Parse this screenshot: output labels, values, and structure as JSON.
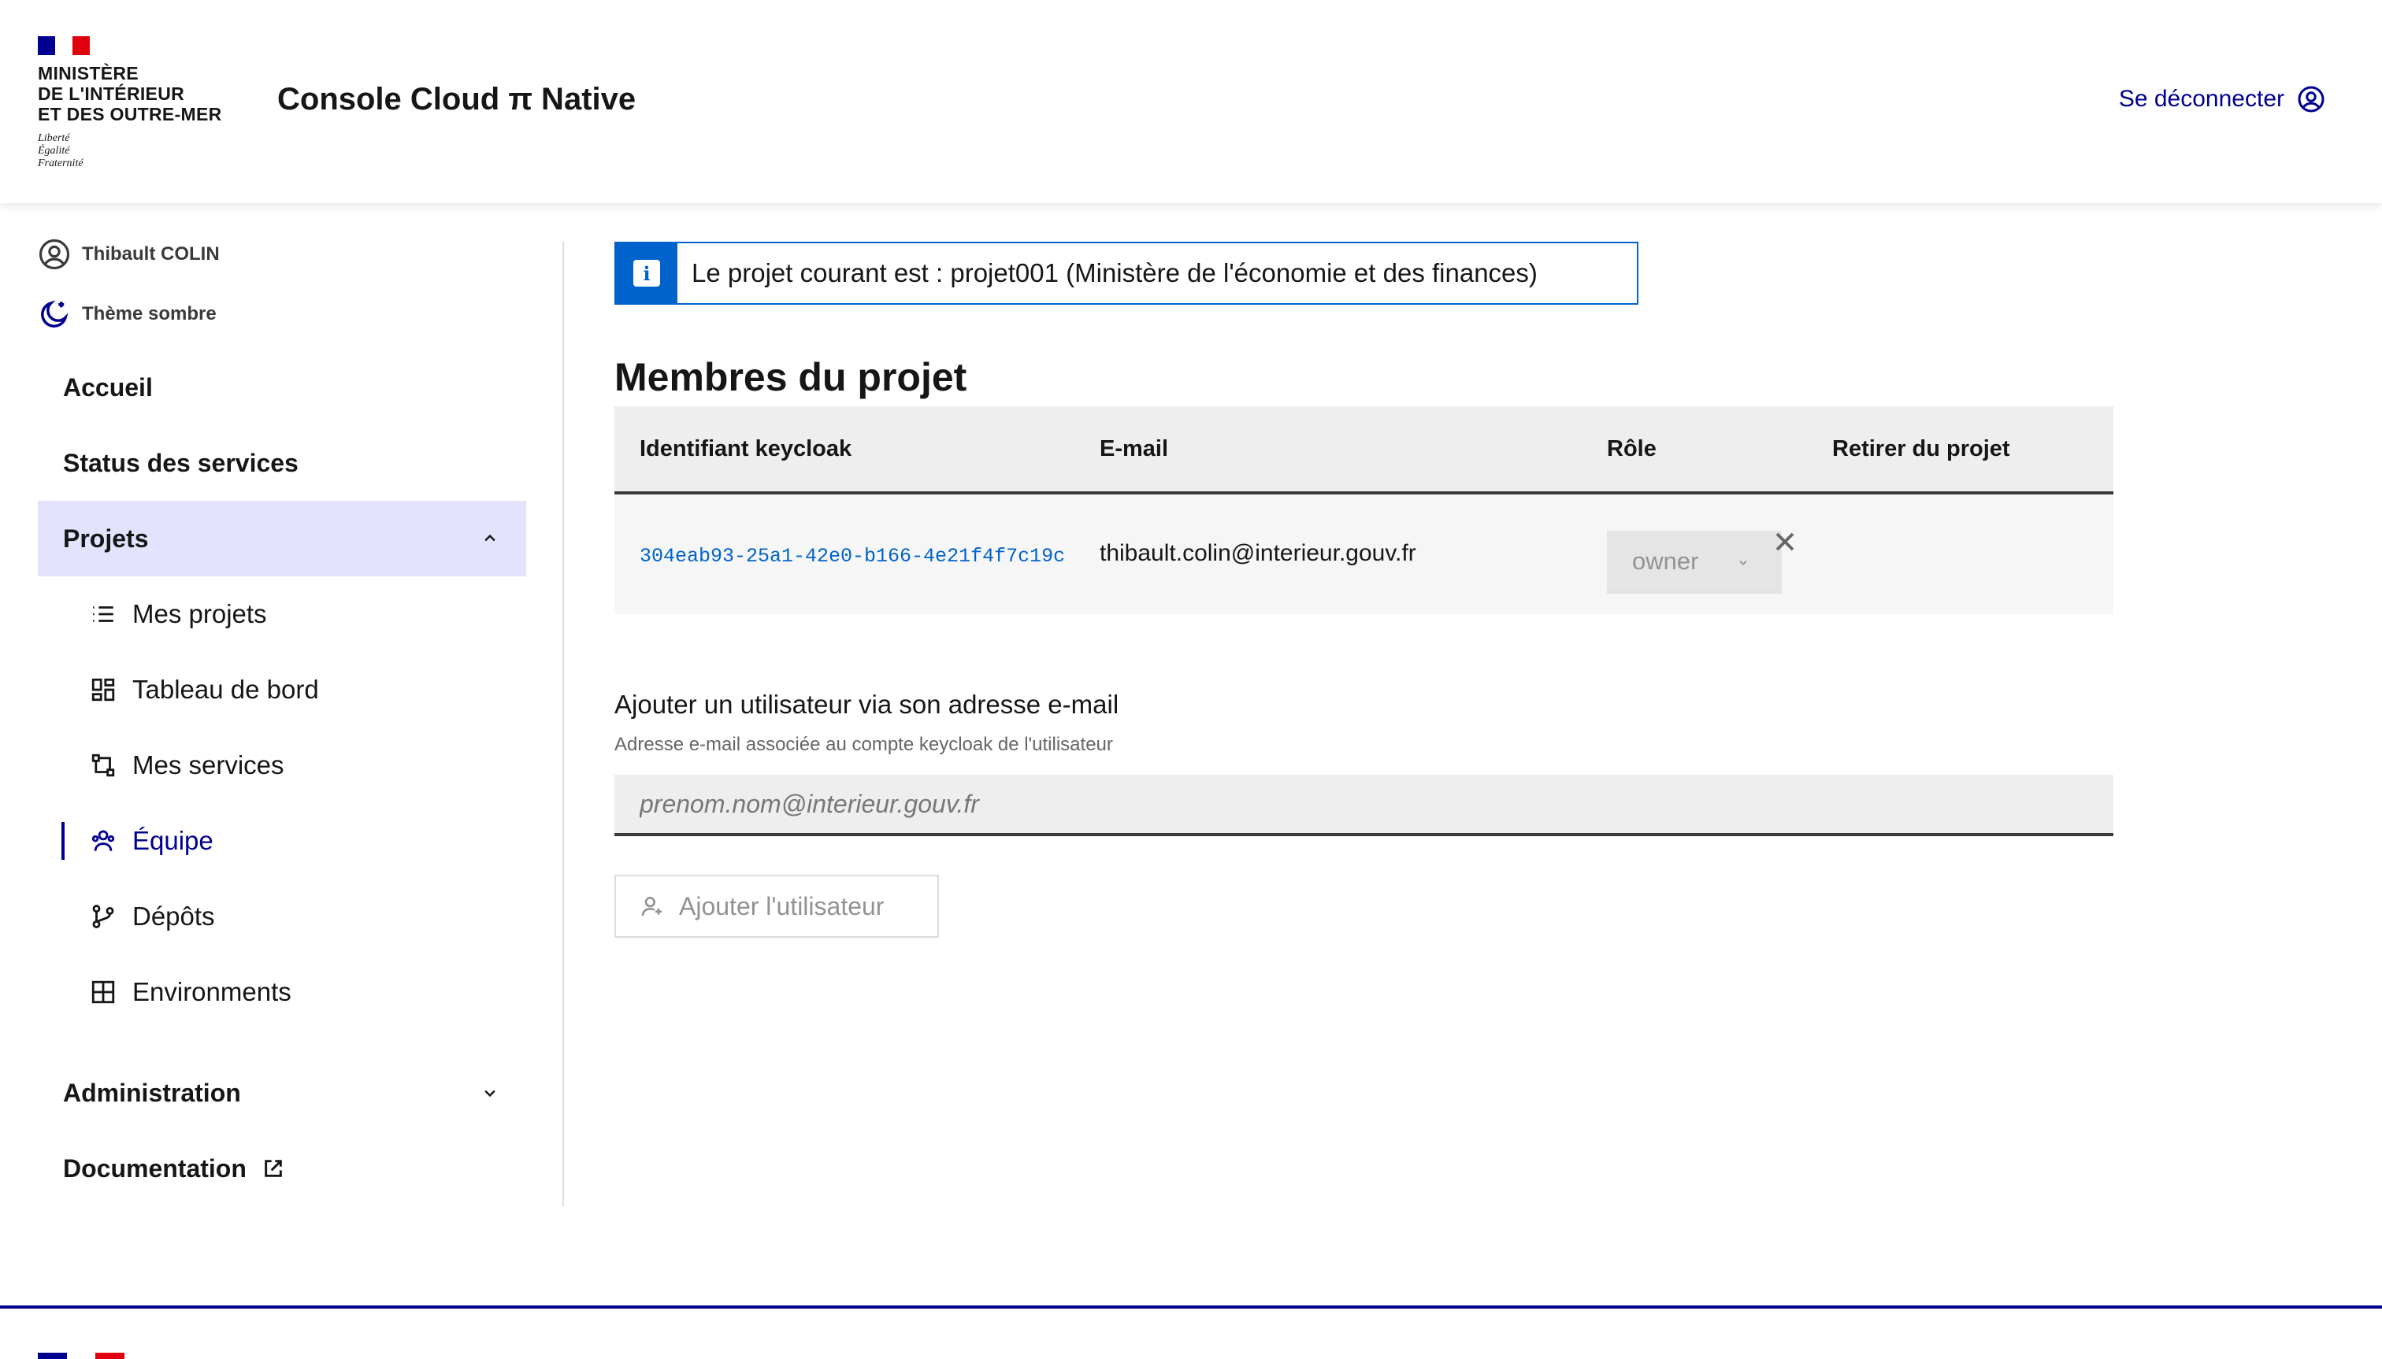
{
  "header": {
    "ministry_line1": "Ministère",
    "ministry_line2": "de l'Intérieur",
    "ministry_line3": "et des Outre-mer",
    "motto1": "Liberté",
    "motto2": "Égalité",
    "motto3": "Fraternité",
    "app_title": "Console Cloud π Native",
    "logout_label": "Se déconnecter"
  },
  "sidebar": {
    "user_name": "Thibault COLIN",
    "theme_label": "Thème sombre",
    "items": {
      "home": "Accueil",
      "status": "Status des services",
      "projects": "Projets",
      "my_projects": "Mes projets",
      "dashboard": "Tableau de bord",
      "my_services": "Mes services",
      "team": "Équipe",
      "repos": "Dépôts",
      "environments": "Environments",
      "admin": "Administration",
      "docs": "Documentation"
    }
  },
  "alert": {
    "text": "Le projet courant est : projet001 (Ministère de l'économie et des finances)"
  },
  "members": {
    "title": "Membres du projet",
    "columns": [
      "Identifiant keycloak",
      "E-mail",
      "Rôle",
      "Retirer du projet"
    ],
    "rows": [
      {
        "keycloak_id": "304eab93-25a1-42e0-b166-4e21f4f7c19c",
        "email": "thibault.colin@interieur.gouv.fr",
        "role": "owner"
      }
    ]
  },
  "add_user": {
    "label": "Ajouter un utilisateur via son adresse e-mail",
    "hint": "Adresse e-mail associée au compte keycloak de l'utilisateur",
    "placeholder": "prenom.nom@interieur.gouv.fr",
    "button_label": "Ajouter l'utilisateur"
  },
  "colors": {
    "primary": "#000091",
    "info": "#0063cb",
    "active_bg": "#e3e3fd",
    "flag_red": "#e1000f"
  }
}
